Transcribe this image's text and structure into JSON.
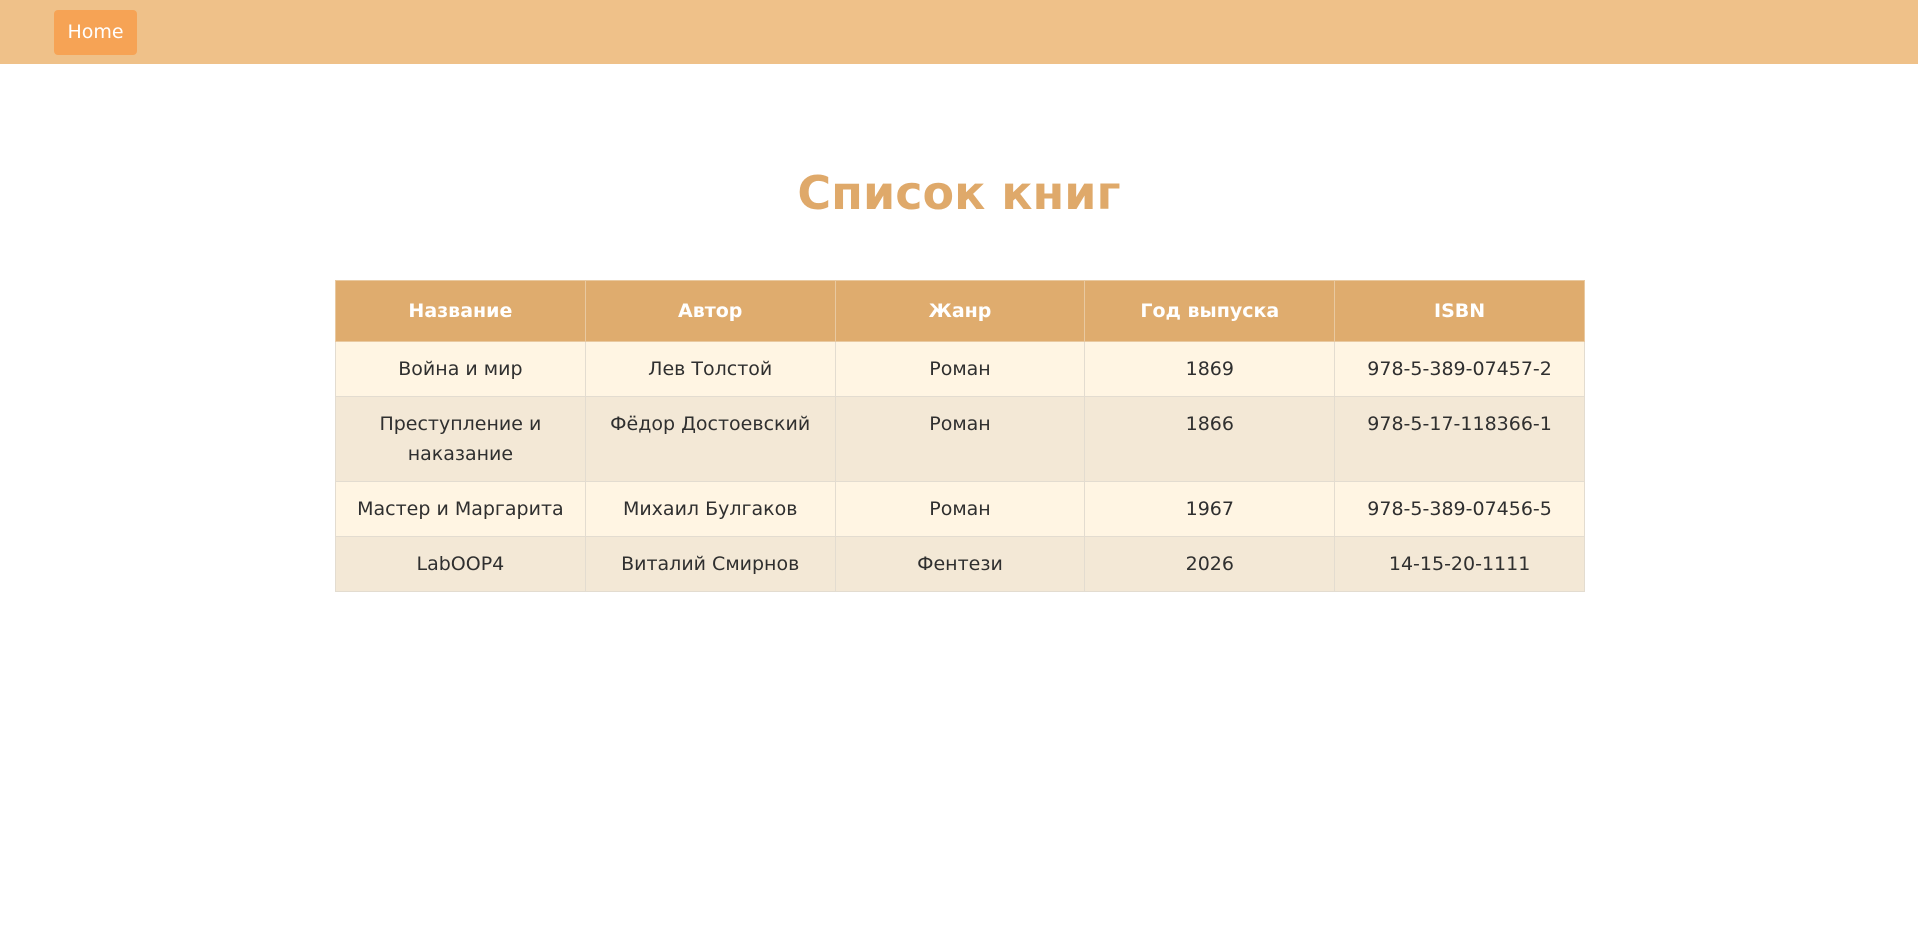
{
  "nav": {
    "home_label": "Home"
  },
  "page": {
    "title": "Список книг"
  },
  "table": {
    "headers": [
      "Название",
      "Автор",
      "Жанр",
      "Год выпуска",
      "ISBN"
    ],
    "rows": [
      [
        "Война и мир",
        "Лев Толстой",
        "Роман",
        "1869",
        "978-5-389-07457-2"
      ],
      [
        "Преступление и наказание",
        "Фёдор Достоевский",
        "Роман",
        "1866",
        "978-5-17-118366-1"
      ],
      [
        "Мастер и Маргарита",
        "Михаил Булгаков",
        "Роман",
        "1967",
        "978-5-389-07456-5"
      ],
      [
        "LabOOP4",
        "Виталий Смирнов",
        "Фентези",
        "2026",
        "14-15-20-1111"
      ]
    ]
  },
  "colors": {
    "topbar": "#efc189",
    "home_button": "#f6a355",
    "title": "#dfa96a",
    "header_bg": "#dfac6e",
    "row_odd": "#fff5e3",
    "row_even": "#f3e8d6"
  }
}
